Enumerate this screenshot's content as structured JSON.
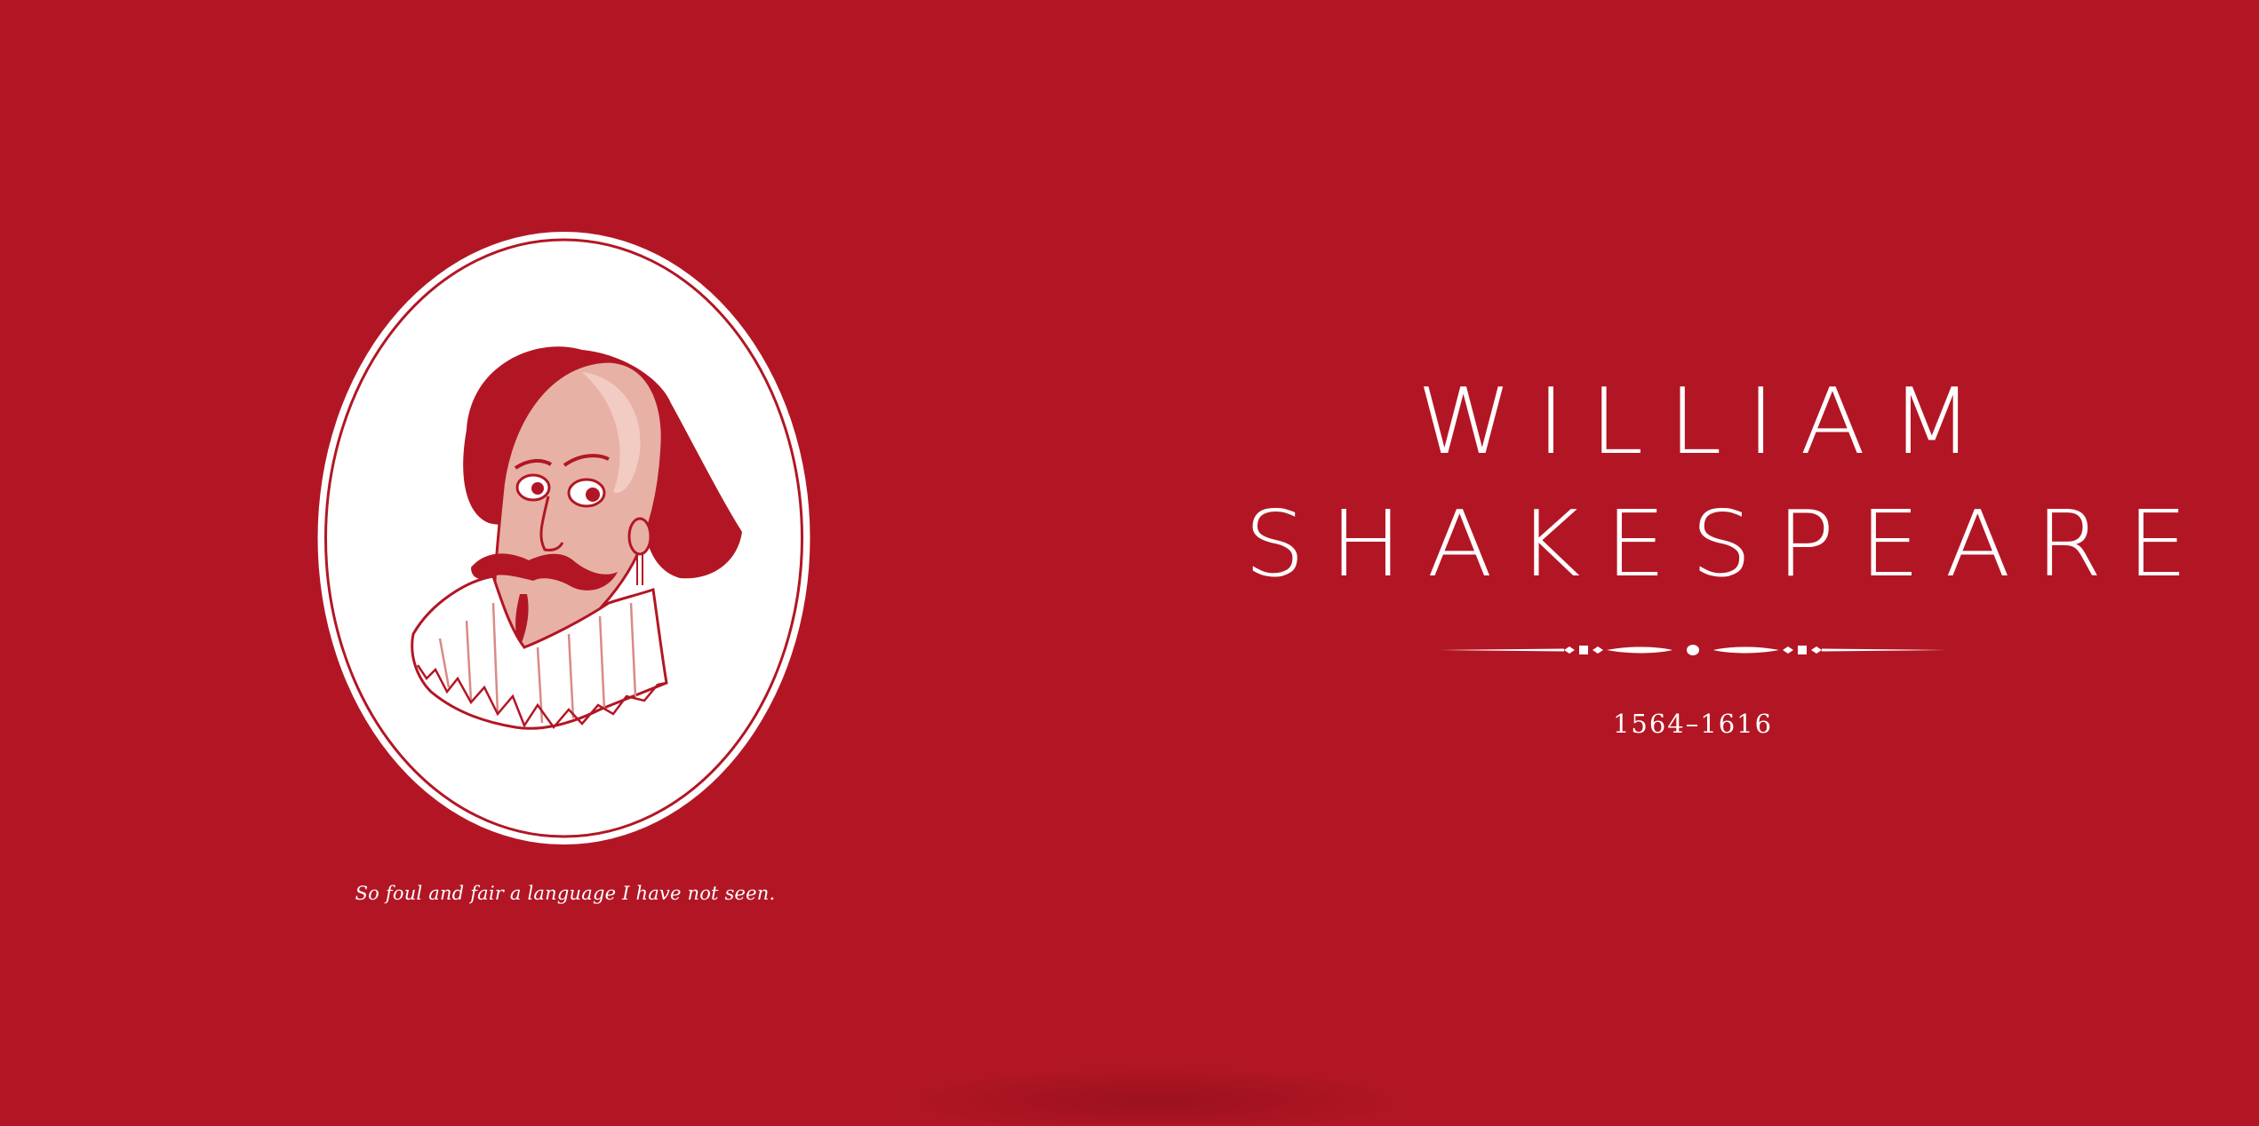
{
  "page": {
    "background_color": "#b21624",
    "text_color": "#ffffff"
  },
  "portrait": {
    "frame_shape": "oval",
    "icon": "shakespeare-caricature"
  },
  "quote": "So foul and fair a language I have not seen.",
  "title": {
    "first_name": "WILLIAM",
    "last_name": "SHAKESPEARE"
  },
  "divider": {
    "icon": "ornamental-divider"
  },
  "dates": "1564–1616"
}
